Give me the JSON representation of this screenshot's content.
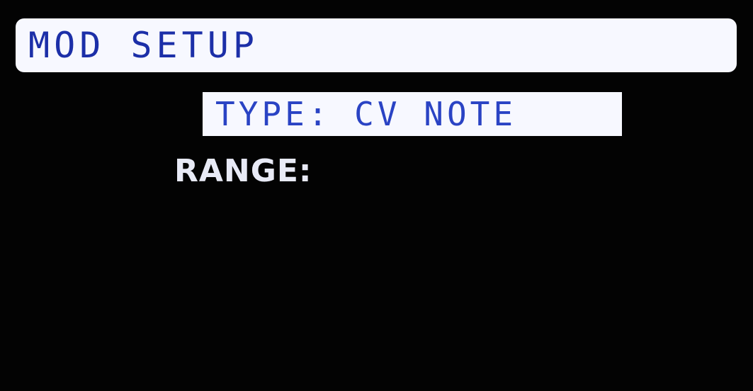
{
  "header": {
    "title": "MOD SETUP"
  },
  "menu": {
    "items": [
      {
        "label": "TYPE: CV NOTE",
        "selected": true
      },
      {
        "label": "RANGE:",
        "selected": false
      }
    ]
  },
  "colors": {
    "background": "#030303",
    "highlight_bg": "#f7f8ff",
    "highlight_text": "#1c2fa8",
    "normal_text": "#e8eaf6"
  }
}
